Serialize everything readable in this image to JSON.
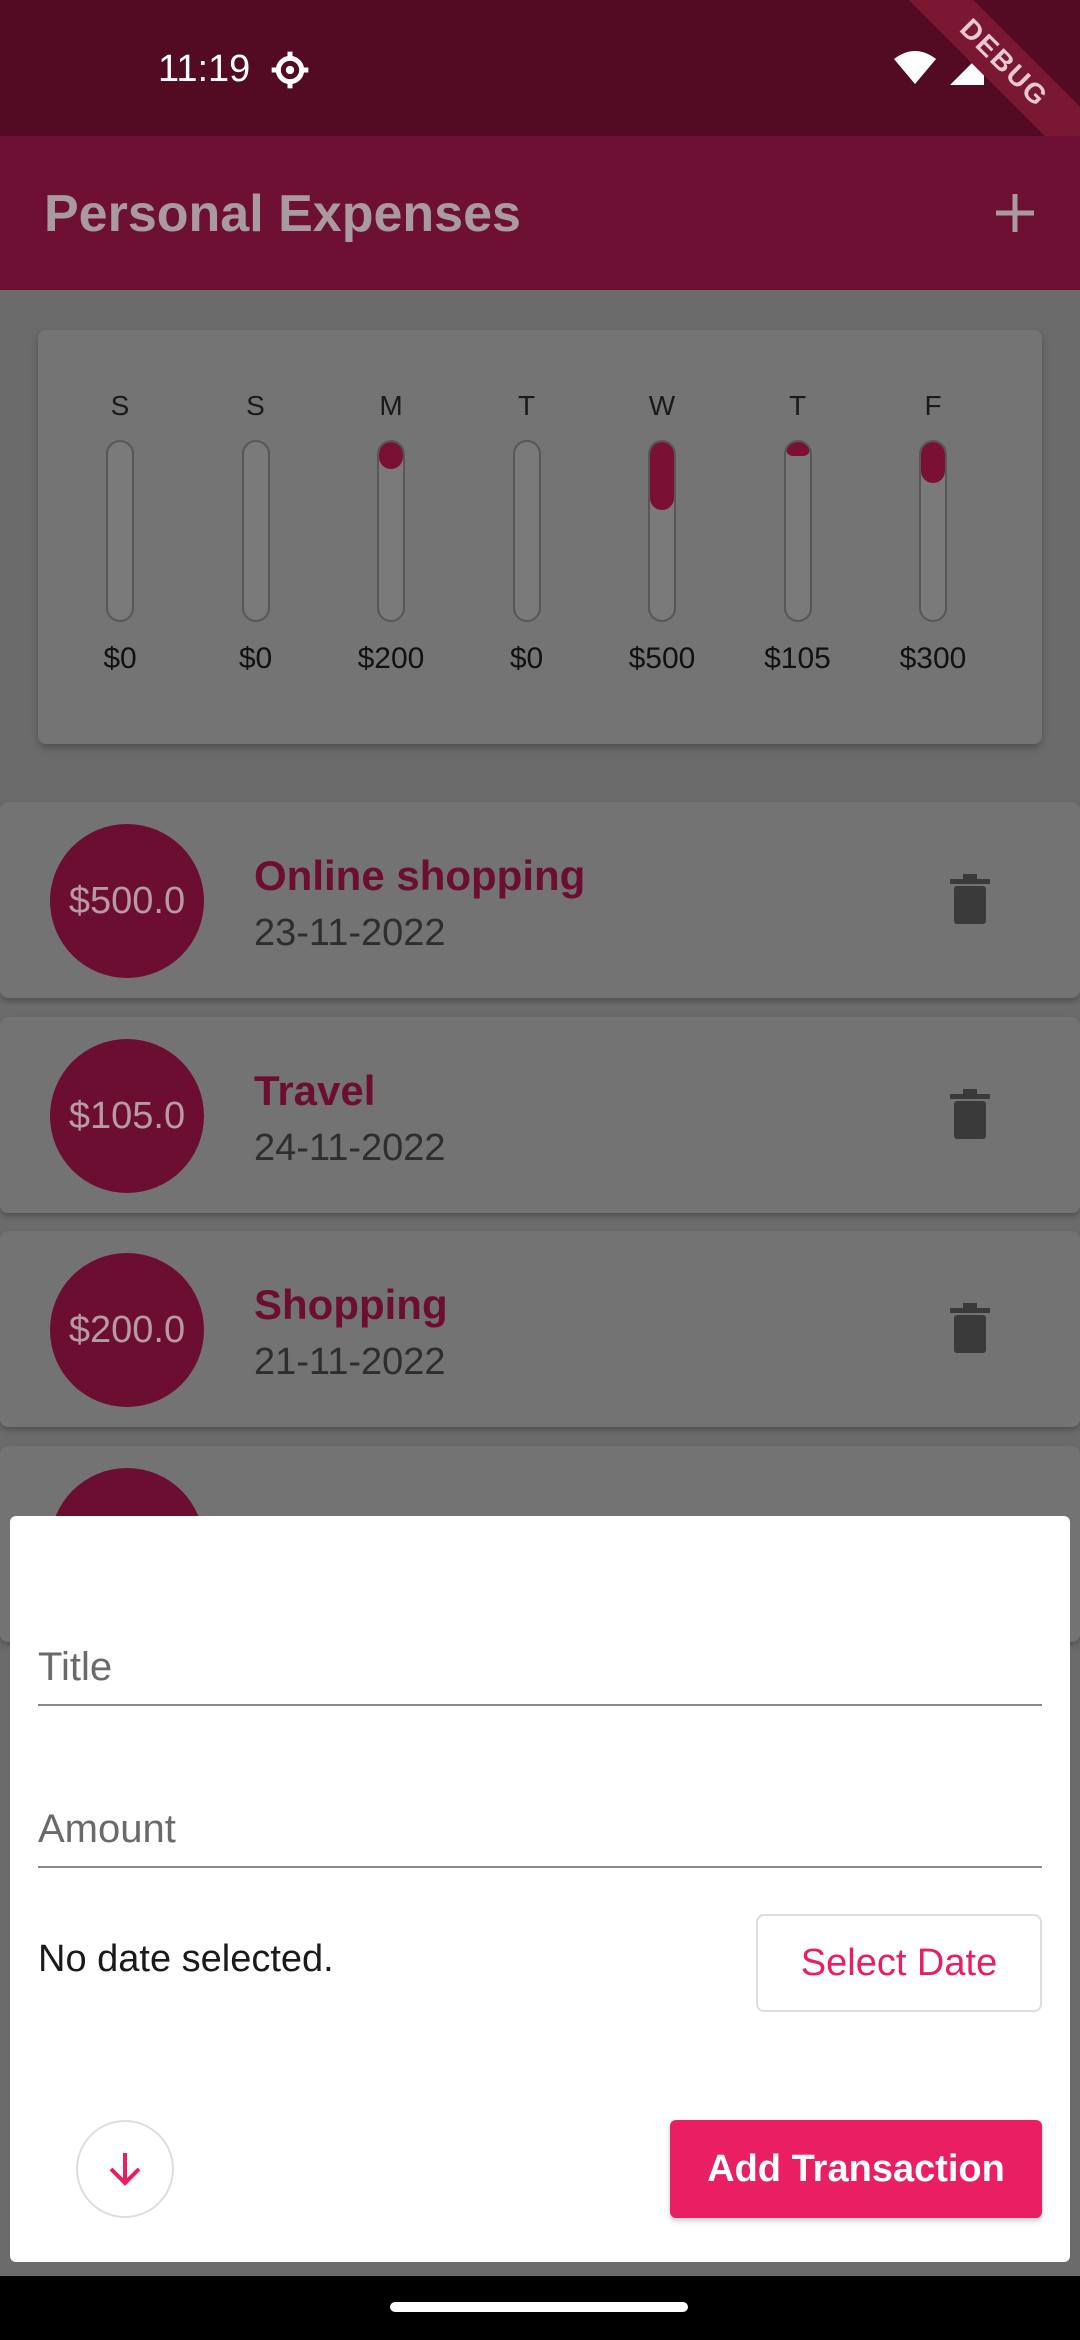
{
  "status_bar": {
    "time": "11:19",
    "debug_label": "DEBUG"
  },
  "app_bar": {
    "title": "Personal Expenses",
    "add_icon": "plus-icon"
  },
  "chart_data": {
    "type": "bar",
    "categories": [
      "S",
      "S",
      "M",
      "T",
      "W",
      "T",
      "F"
    ],
    "values": [
      0,
      0,
      200,
      0,
      500,
      105,
      300
    ],
    "value_labels": [
      "$0",
      "$0",
      "$200",
      "$0",
      "$500",
      "$105",
      "$300"
    ],
    "fill_fraction": [
      0,
      0,
      0.152,
      0,
      0.38,
      0.08,
      0.228
    ],
    "color": "#7a1034"
  },
  "transactions": [
    {
      "amount": "$500.0",
      "title": "Online shopping",
      "date": "23-11-2022"
    },
    {
      "amount": "$105.0",
      "title": "Travel",
      "date": "24-11-2022"
    },
    {
      "amount": "$200.0",
      "title": "Shopping",
      "date": "21-11-2022"
    },
    {
      "amount": "",
      "title": "",
      "date": ""
    }
  ],
  "sheet": {
    "title_placeholder": "Title",
    "amount_placeholder": "Amount",
    "date_status": "No date selected.",
    "select_date_label": "Select Date",
    "add_label": "Add Transaction",
    "accent": "#e91e63"
  }
}
